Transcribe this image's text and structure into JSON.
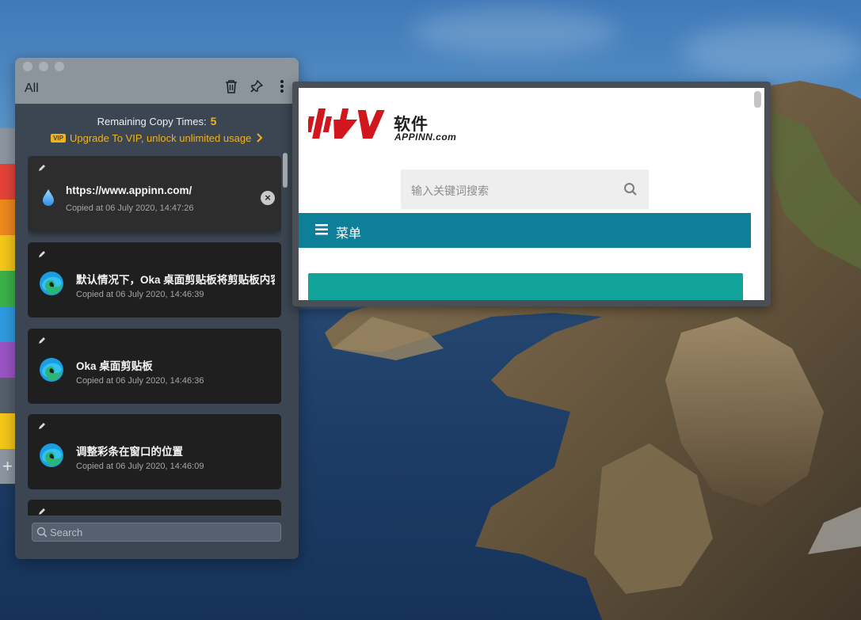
{
  "panel": {
    "tab_label": "All",
    "remaining_label": "Remaining Copy Times:",
    "remaining_count": "5",
    "vip_badge": "VIP",
    "vip_text": "Upgrade To VIP, unlock unlimited usage",
    "search_placeholder": "Search",
    "clips": [
      {
        "title": "https://www.appinn.com/",
        "time": "Copied at 06 July 2020, 14:47:26",
        "app_icon": "water-drop-icon"
      },
      {
        "title": "默认情况下，Oka 桌面剪贴板将剪贴板内容",
        "time": "Copied at 06 July 2020, 14:46:39",
        "app_icon": "edge-browser-icon"
      },
      {
        "title": "Oka 桌面剪贴板",
        "time": "Copied at 06 July 2020, 14:46:36",
        "app_icon": "edge-browser-icon"
      },
      {
        "title": "调整彩条在窗口的位置",
        "time": "Copied at 06 July 2020, 14:46:09",
        "app_icon": "edge-browser-icon"
      }
    ]
  },
  "preview": {
    "logo_cn": "软件",
    "logo_en": "APPINN.com",
    "search_placeholder": "输入关键词搜索",
    "menu_label": "菜单"
  },
  "colors": {
    "panel_bg": "#3b4652",
    "accent_orange": "#f2b21b",
    "menu_teal": "#0e7f99",
    "logo_red": "#d2161e",
    "strip": [
      "#8d96a0",
      "#e5433a",
      "#ef8a1c",
      "#f5c71a",
      "#3cb14a",
      "#2f9be0",
      "#9a55c5",
      "#56606c",
      "#f5c71a"
    ]
  }
}
